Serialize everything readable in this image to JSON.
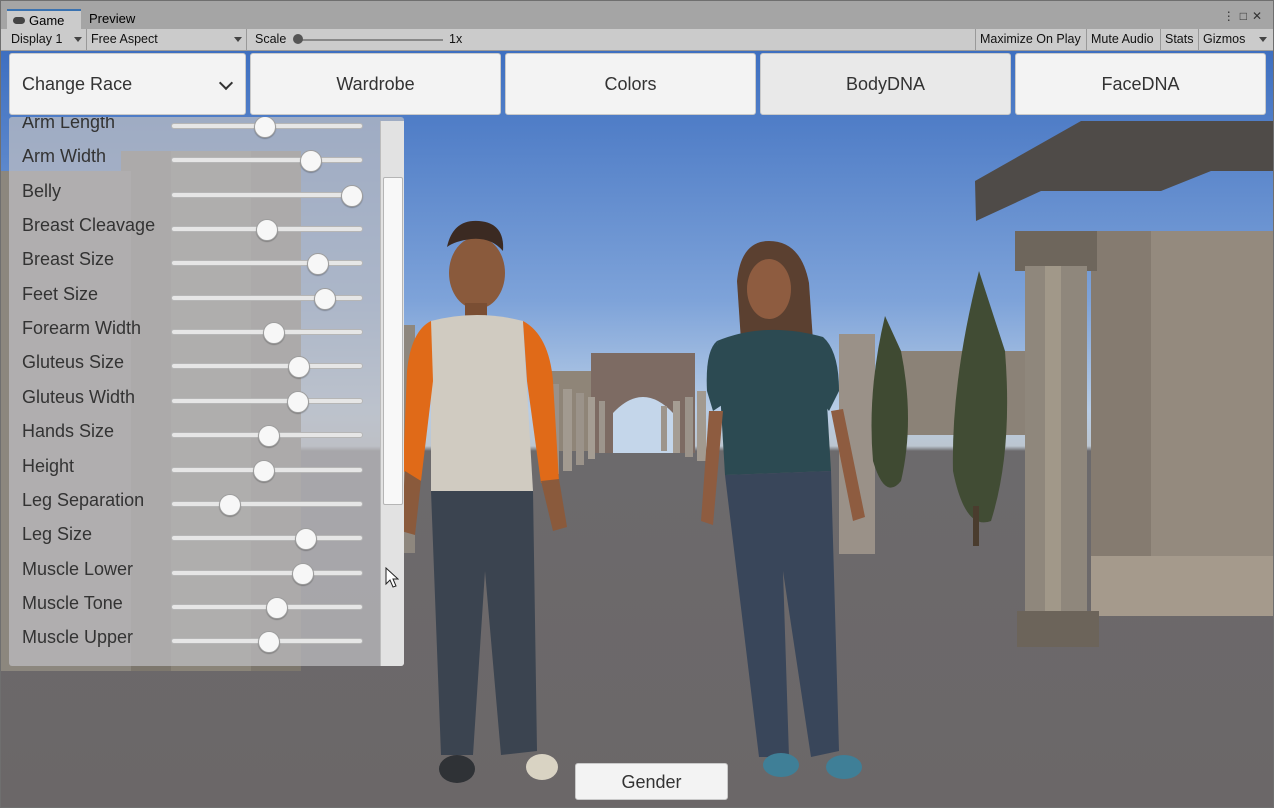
{
  "editor": {
    "tabs": [
      {
        "label": "Game",
        "icon": "gamepad-icon",
        "active": true
      },
      {
        "label": "Preview",
        "active": false
      }
    ]
  },
  "toolbar": {
    "display": "Display 1",
    "aspect": "Free Aspect",
    "scale_label": "Scale",
    "scale_value": "1x",
    "maximize": "Maximize On Play",
    "mute": "Mute Audio",
    "stats": "Stats",
    "gizmos": "Gizmos"
  },
  "menu": {
    "race": "Change Race",
    "wardrobe": "Wardrobe",
    "colors": "Colors",
    "body_dna": "BodyDNA",
    "face_dna": "FaceDNA"
  },
  "dna_sliders": [
    {
      "label": "Arm Length",
      "value": 0.49
    },
    {
      "label": "Arm Width",
      "value": 0.76
    },
    {
      "label": "Belly",
      "value": 1.0
    },
    {
      "label": "Breast Cleavage",
      "value": 0.5
    },
    {
      "label": "Breast Size",
      "value": 0.8
    },
    {
      "label": "Feet Size",
      "value": 0.84
    },
    {
      "label": "Forearm Width",
      "value": 0.54
    },
    {
      "label": "Gluteus Size",
      "value": 0.69
    },
    {
      "label": "Gluteus Width",
      "value": 0.68
    },
    {
      "label": "Hands Size",
      "value": 0.51
    },
    {
      "label": "Height",
      "value": 0.48
    },
    {
      "label": "Leg Separation",
      "value": 0.28
    },
    {
      "label": "Leg Size",
      "value": 0.73
    },
    {
      "label": "Muscle Lower",
      "value": 0.71
    },
    {
      "label": "Muscle Tone",
      "value": 0.56
    },
    {
      "label": "Muscle Upper",
      "value": 0.51
    }
  ],
  "gender_button": "Gender"
}
